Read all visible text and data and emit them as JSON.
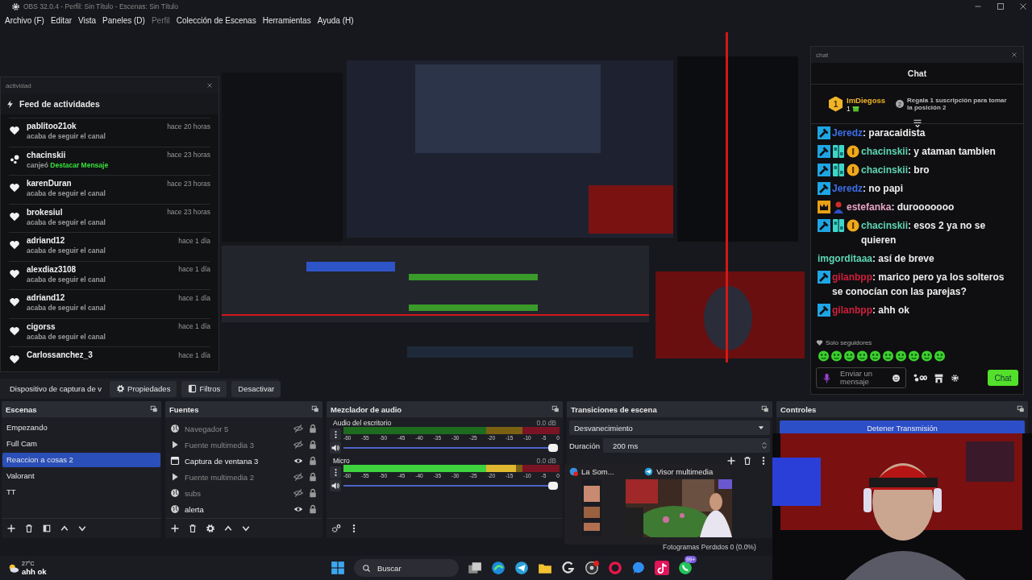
{
  "window": {
    "title": "OBS 32.0.4 - Perfil: Sin Título - Escenas: Sin Título"
  },
  "menu": [
    {
      "label": "Archivo (F)",
      "disabled": false
    },
    {
      "label": "Editar",
      "disabled": false
    },
    {
      "label": "Vista",
      "disabled": false
    },
    {
      "label": "Paneles (D)",
      "disabled": false
    },
    {
      "label": "Perfil",
      "disabled": true
    },
    {
      "label": "Colección de Escenas",
      "disabled": false
    },
    {
      "label": "Herramientas",
      "disabled": false
    },
    {
      "label": "Ayuda (H)",
      "disabled": false
    }
  ],
  "activity_dock": {
    "title": "actividad",
    "heading": "Feed de actividades",
    "events": [
      {
        "kind": "follow",
        "user": "pablitoo21ok",
        "time": "hace 20 horas",
        "message": "acaba de seguir el canal"
      },
      {
        "kind": "redeem",
        "user": "chacinskii",
        "time": "hace 23 horas",
        "message": "canjeó",
        "reward": "Destacar Mensaje"
      },
      {
        "kind": "follow",
        "user": "karenDuran",
        "time": "hace 23 horas",
        "message": "acaba de seguir el canal"
      },
      {
        "kind": "follow",
        "user": "brokesiul",
        "time": "hace 23 horas",
        "message": "acaba de seguir el canal"
      },
      {
        "kind": "follow",
        "user": "adriand12",
        "time": "hace 1 día",
        "message": "acaba de seguir el canal"
      },
      {
        "kind": "follow",
        "user": "alexdiaz3108",
        "time": "hace 1 día",
        "message": "acaba de seguir el canal"
      },
      {
        "kind": "follow",
        "user": "adriand12",
        "time": "hace 1 día",
        "message": "acaba de seguir el canal"
      },
      {
        "kind": "follow",
        "user": "cigorss",
        "time": "hace 1 día",
        "message": "acaba de seguir el canal"
      },
      {
        "kind": "follow",
        "user": "Carlossanchez_3",
        "time": "hace 1 día"
      }
    ]
  },
  "source_toolbar": {
    "source": "Dispositivo de captura de v",
    "buttons": [
      "Propiedades",
      "Filtros",
      "Desactivar"
    ]
  },
  "scenes": {
    "title": "Escenas",
    "items": [
      {
        "name": "Empezando",
        "selected": false
      },
      {
        "name": "Full Cam",
        "selected": false
      },
      {
        "name": "Reaccion a cosas 2",
        "selected": true
      },
      {
        "name": "Valorant",
        "selected": false
      },
      {
        "name": "TT",
        "selected": false
      }
    ]
  },
  "sources": {
    "title": "Fuentes",
    "items": [
      {
        "kind": "browser",
        "name": "Navegador 5",
        "visible": false,
        "locked": true
      },
      {
        "kind": "media",
        "name": "Fuente multimedia 3",
        "visible": false,
        "locked": true
      },
      {
        "kind": "window",
        "name": "Captura de ventana 3",
        "visible": true,
        "locked": true
      },
      {
        "kind": "media",
        "name": "Fuente multimedia 2",
        "visible": false,
        "locked": true
      },
      {
        "kind": "browser",
        "name": "subs",
        "visible": false,
        "locked": true
      },
      {
        "kind": "browser",
        "name": "alerta",
        "visible": true,
        "locked": true
      }
    ]
  },
  "mixer": {
    "title": "Mezclador de audio",
    "channels": [
      {
        "name": "Audio del escritorio",
        "reading": "0.0 dB",
        "meter": {
          "level": 0
        },
        "volume": {
          "level": 1
        },
        "scale": [
          "-60",
          "-55",
          "-50",
          "-45",
          "-40",
          "-35",
          "-30",
          "-25",
          "-20",
          "-15",
          "-10",
          "-5",
          "0"
        ]
      },
      {
        "name": "Micro",
        "reading": "0.0 dB",
        "meter": {
          "level": 0.8
        },
        "volume": {
          "level": 1
        },
        "scale": [
          "-60",
          "-55",
          "-50",
          "-45",
          "-40",
          "-35",
          "-30",
          "-25",
          "-20",
          "-15",
          "-10",
          "-5",
          "0"
        ]
      }
    ]
  },
  "transitions": {
    "title": "Transiciones de escena",
    "transition": "Desvanecimiento",
    "duration_label": "Duración",
    "duration": "200 ms"
  },
  "controls": {
    "title": "Controles",
    "buttons": [
      "Detener Transmisión"
    ]
  },
  "status_bar": {
    "dropped_frames": "Fotogramas Perdidos 0 (0.0%)"
  },
  "chat_dock": {
    "title": "chat",
    "header": "Chat",
    "leader": {
      "rank": "1",
      "user": "ImDiegoss",
      "count": "1"
    },
    "next": {
      "rank": "2",
      "text": "Regala 1 suscripción para tomar la posición 2"
    },
    "messages": [
      {
        "kind": "moderator",
        "user": "Jeredz",
        "color": "#3d6ee8",
        "text": ": paracaidista"
      },
      {
        "kind": "subscriber",
        "user": "chacinskii",
        "color": "#5ed6b4",
        "text": ": y ataman tambien"
      },
      {
        "kind": "subscriber",
        "user": "chacinskii",
        "color": "#5ed6b4",
        "text": ": bro"
      },
      {
        "kind": "moderator",
        "user": "Jeredz",
        "color": "#3d6ee8",
        "text": ": no papi"
      },
      {
        "kind": "vip",
        "user": "estefanka",
        "color": "#e9a3c4",
        "text": ": durooooooo"
      },
      {
        "kind": "subscriber",
        "user": "chacinskii",
        "color": "#5ed6b4",
        "text": ": esos 2 ya no se quieren"
      },
      {
        "kind": "viewer",
        "user": "imgorditaaa",
        "color": "#5ed6b4",
        "text": ": así de breve"
      },
      {
        "kind": "moderator",
        "user": "gilanbpp",
        "color": "#d11f3c",
        "text": ": marico pero ya los solteros se conocían con las parejas?"
      },
      {
        "kind": "moderator",
        "user": "gilanbpp",
        "color": "#d11f3c",
        "text": ": ahh ok"
      }
    ],
    "mode": "Solo seguidores",
    "input": {
      "placeholder": "Enviar un mensaje"
    },
    "send": "Chat"
  },
  "taskbar": {
    "weather": "27°C",
    "overlay_text": "ahh ok",
    "search": "Buscar",
    "apps": [
      {
        "kind": "widgets"
      },
      {
        "kind": "desktops"
      },
      {
        "kind": "edge"
      },
      {
        "kind": "telegram"
      },
      {
        "kind": "folder"
      },
      {
        "kind": "g"
      },
      {
        "kind": "obs"
      },
      {
        "kind": "opera"
      },
      {
        "kind": "messenger"
      },
      {
        "kind": "tiktok"
      },
      {
        "kind": "whatsapp",
        "badge": "99+"
      }
    ]
  },
  "taskbar_popup": {
    "windows": [
      {
        "title": "La Som..."
      },
      {
        "title": "Visor multimedia"
      }
    ]
  }
}
